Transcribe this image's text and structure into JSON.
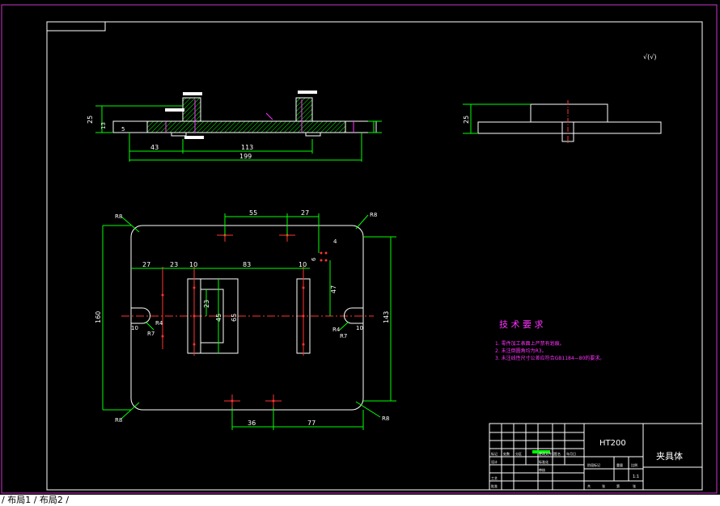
{
  "tabs": "/ 布局1 / 布局2 /",
  "dims": {
    "front_height": "25",
    "front_small": "13",
    "front_step": "5",
    "front_43": "43",
    "front_113": "113",
    "front_199": "199",
    "side_height": "25",
    "top_55": "55",
    "top_27a": "27",
    "top_27b": "27",
    "top_23": "23",
    "top_10a": "10",
    "top_83": "83",
    "top_10b": "10",
    "top_4": "4",
    "top_6": "6",
    "top_47": "47",
    "top_23v": "23",
    "top_45": "45",
    "top_65": "65",
    "top_160": "160",
    "top_143": "143",
    "top_36": "36",
    "top_77": "77",
    "r8_tl": "R8",
    "r8_tr": "R8",
    "r8_bl": "R8",
    "r8_br": "R8",
    "r4_l": "R4",
    "r7_l": "R7",
    "r4_r": "R4",
    "r7_r": "R7",
    "r10_l": "10",
    "r10_r": "10"
  },
  "tech": {
    "title": "技 术 要 求",
    "items": [
      "1.  零件加工表面上严禁有划痕。",
      "2.  未注倒圆角均为R3。",
      "3.  未注线性尺寸公差应符合GB1184—80的要求。"
    ]
  },
  "title_block": {
    "material": "HT200",
    "part_name": "夹具体",
    "scale": "1:1",
    "header_cells": [
      "标记",
      "处数",
      "分区",
      "更改文件号",
      "签名",
      "年月日"
    ],
    "row_labels": [
      "设计",
      "标准化",
      "审核",
      "工艺",
      "批准"
    ],
    "stage_cells": [
      "阶段标记",
      "重量",
      "比例"
    ],
    "bottom_cells": [
      "共",
      "张",
      "第",
      "张"
    ]
  },
  "colors": {
    "outline": "#ffffff",
    "dimension": "#00ff00",
    "centerline": "#ff3333",
    "hatch": "#00ff00",
    "magenta": "#ff33ff",
    "frame_outer": "#cc33cc"
  }
}
